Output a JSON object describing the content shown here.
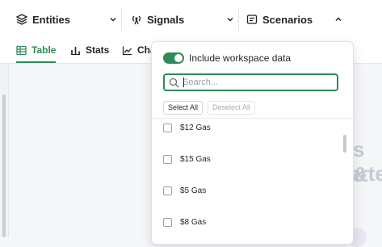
{
  "nav": {
    "entities_label": "Entities",
    "signals_label": "Signals",
    "scenarios_label": "Scenarios"
  },
  "tabs": {
    "table_label": "Table",
    "stats_label": "Stats",
    "charts_label": "Cha"
  },
  "background": {
    "line1": "s &",
    "line2": "arte"
  },
  "dropdown": {
    "include_label": "Include workspace data",
    "include_on": true,
    "search_placeholder": "Search...",
    "select_all": "Select All",
    "deselect_all": "Deselect All",
    "options": [
      "$12 Gas",
      "$15 Gas",
      "$5 Gas",
      "$8 Gas"
    ]
  },
  "colors": {
    "accent": "#2e8b57"
  }
}
